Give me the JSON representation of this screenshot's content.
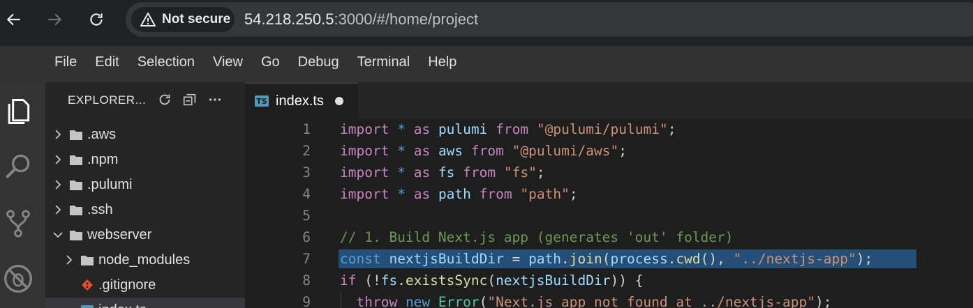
{
  "browser": {
    "security_label": "Not secure",
    "url_host": "54.218.250.5",
    "url_rest": ":3000/#/home/project"
  },
  "menu": [
    "File",
    "Edit",
    "Selection",
    "View",
    "Go",
    "Debug",
    "Terminal",
    "Help"
  ],
  "explorer": {
    "title": "EXPLORER...",
    "tree": [
      {
        "label": ".aws",
        "type": "folder",
        "expanded": false,
        "depth": 0
      },
      {
        "label": ".npm",
        "type": "folder",
        "expanded": false,
        "depth": 0
      },
      {
        "label": ".pulumi",
        "type": "folder",
        "expanded": false,
        "depth": 0
      },
      {
        "label": ".ssh",
        "type": "folder",
        "expanded": false,
        "depth": 0
      },
      {
        "label": "webserver",
        "type": "folder",
        "expanded": true,
        "depth": 0
      },
      {
        "label": "node_modules",
        "type": "folder",
        "expanded": false,
        "depth": 1
      },
      {
        "label": ".gitignore",
        "type": "git",
        "depth": 1
      },
      {
        "label": "index.ts",
        "type": "ts",
        "depth": 1
      }
    ]
  },
  "tab": {
    "icon_label": "TS",
    "name": "index.ts"
  },
  "editor": {
    "lines": [
      {
        "n": "1",
        "tokens": [
          [
            "kw",
            "import"
          ],
          [
            "op",
            " "
          ],
          [
            "kw2",
            "*"
          ],
          [
            "op",
            " "
          ],
          [
            "kw",
            "as"
          ],
          [
            "op",
            " "
          ],
          [
            "id",
            "pulumi"
          ],
          [
            "op",
            " "
          ],
          [
            "kw",
            "from"
          ],
          [
            "op",
            " "
          ],
          [
            "str",
            "\"@pulumi/pulumi\""
          ],
          [
            "op",
            ";"
          ]
        ]
      },
      {
        "n": "2",
        "tokens": [
          [
            "kw",
            "import"
          ],
          [
            "op",
            " "
          ],
          [
            "kw2",
            "*"
          ],
          [
            "op",
            " "
          ],
          [
            "kw",
            "as"
          ],
          [
            "op",
            " "
          ],
          [
            "id",
            "aws"
          ],
          [
            "op",
            " "
          ],
          [
            "kw",
            "from"
          ],
          [
            "op",
            " "
          ],
          [
            "str",
            "\"@pulumi/aws\""
          ],
          [
            "op",
            ";"
          ]
        ]
      },
      {
        "n": "3",
        "tokens": [
          [
            "kw",
            "import"
          ],
          [
            "op",
            " "
          ],
          [
            "kw2",
            "*"
          ],
          [
            "op",
            " "
          ],
          [
            "kw",
            "as"
          ],
          [
            "op",
            " "
          ],
          [
            "id",
            "fs"
          ],
          [
            "op",
            " "
          ],
          [
            "kw",
            "from"
          ],
          [
            "op",
            " "
          ],
          [
            "str",
            "\"fs\""
          ],
          [
            "op",
            ";"
          ]
        ]
      },
      {
        "n": "4",
        "tokens": [
          [
            "kw",
            "import"
          ],
          [
            "op",
            " "
          ],
          [
            "kw2",
            "*"
          ],
          [
            "op",
            " "
          ],
          [
            "kw",
            "as"
          ],
          [
            "op",
            " "
          ],
          [
            "id",
            "path"
          ],
          [
            "op",
            " "
          ],
          [
            "kw",
            "from"
          ],
          [
            "op",
            " "
          ],
          [
            "str",
            "\"path\""
          ],
          [
            "op",
            ";"
          ]
        ]
      },
      {
        "n": "5",
        "tokens": []
      },
      {
        "n": "6",
        "tokens": [
          [
            "cm",
            "// 1. Build Next.js app (generates 'out' folder)"
          ]
        ]
      },
      {
        "n": "7",
        "selected": true,
        "tokens": [
          [
            "kw2",
            "const"
          ],
          [
            "op",
            " "
          ],
          [
            "id",
            "nextjsBuildDir"
          ],
          [
            "op",
            " = "
          ],
          [
            "id",
            "path"
          ],
          [
            "op",
            "."
          ],
          [
            "fn",
            "join"
          ],
          [
            "op",
            "("
          ],
          [
            "id",
            "process"
          ],
          [
            "op",
            "."
          ],
          [
            "fn",
            "cwd"
          ],
          [
            "op",
            "(), "
          ],
          [
            "str",
            "\"../nextjs-app\""
          ],
          [
            "op",
            ");"
          ]
        ]
      },
      {
        "n": "8",
        "tokens": [
          [
            "kw",
            "if"
          ],
          [
            "op",
            " (!"
          ],
          [
            "id",
            "fs"
          ],
          [
            "op",
            "."
          ],
          [
            "fn",
            "existsSync"
          ],
          [
            "op",
            "("
          ],
          [
            "id",
            "nextjsBuildDir"
          ],
          [
            "op",
            ")) {"
          ]
        ]
      },
      {
        "n": "9",
        "indent": true,
        "tokens": [
          [
            "op",
            "  "
          ],
          [
            "kw",
            "throw"
          ],
          [
            "op",
            " "
          ],
          [
            "kw2",
            "new"
          ],
          [
            "op",
            " "
          ],
          [
            "cls",
            "Error"
          ],
          [
            "op",
            "("
          ],
          [
            "str",
            "\"Next.js app not found at ../nextjs-app\""
          ],
          [
            "op",
            ");"
          ]
        ]
      }
    ]
  }
}
